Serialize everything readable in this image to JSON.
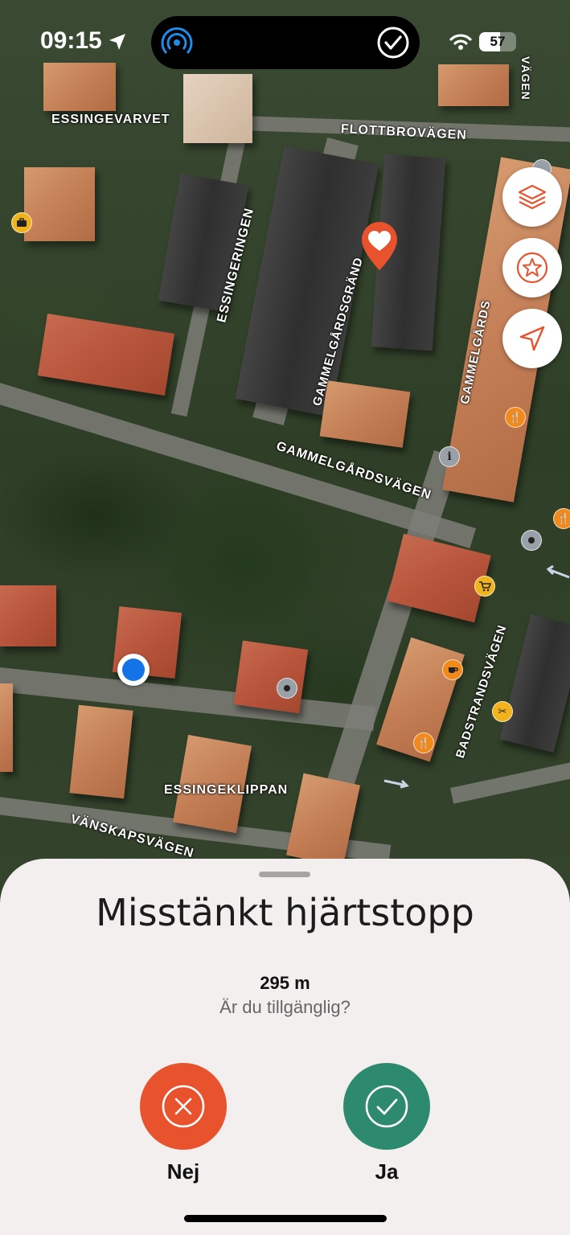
{
  "status_bar": {
    "time": "09:15",
    "battery": "57"
  },
  "map": {
    "labels": {
      "essingevarvet": "ESSINGEVARVET",
      "flottbrovagen": "FLOTTBROVÄGEN",
      "essingeringen": "ESSINGERINGEN",
      "gammelgardsgrand": "GAMMELGÅRDSGRÄND",
      "gammelgards": "GAMMELGÅRDS",
      "gammelgardsvagen": "GAMMELGÅRDSVÄGEN",
      "badstrandsvagen": "BADSTRANDSVÄGEN",
      "essingeklippan": "ESSINGEKLIPPAN",
      "vanskapsvagen": "VÄNSKAPSVÄGEN",
      "top_edge": "VÄGEN"
    },
    "colors": {
      "accent": "#e8522c",
      "user_location": "#1473e6"
    }
  },
  "sheet": {
    "title": "Misstänkt hjärtstopp",
    "distance": "295 m",
    "question": "Är du tillgänglig?",
    "no_label": "Nej",
    "yes_label": "Ja",
    "colors": {
      "no": "#e8522c",
      "yes": "#2e8a6e"
    }
  }
}
